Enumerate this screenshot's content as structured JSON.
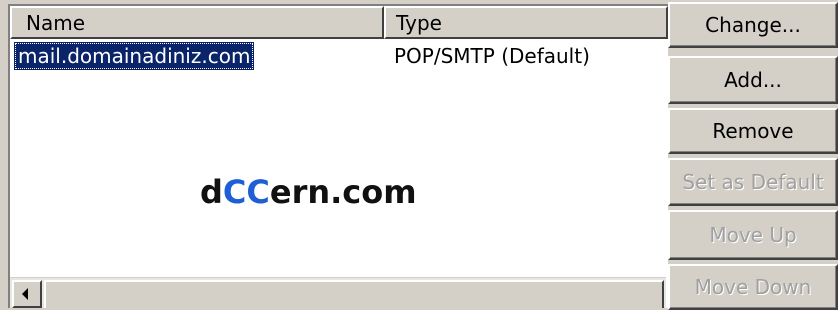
{
  "list": {
    "columns": {
      "name": "Name",
      "type": "Type"
    },
    "rows": [
      {
        "name": "mail.domainadiniz.com",
        "type": "POP/SMTP (Default)"
      }
    ]
  },
  "watermark": {
    "part1": "d",
    "part2": "CC",
    "part3": "ern.com"
  },
  "buttons": {
    "change": "Change...",
    "add": "Add...",
    "remove": "Remove",
    "set_default": "Set as Default",
    "move_up": "Move Up",
    "move_down": "Move Down"
  },
  "colors": {
    "selection": "#0a246a",
    "face": "#d4d0c8",
    "watermark_accent": "#1f5fd6"
  }
}
